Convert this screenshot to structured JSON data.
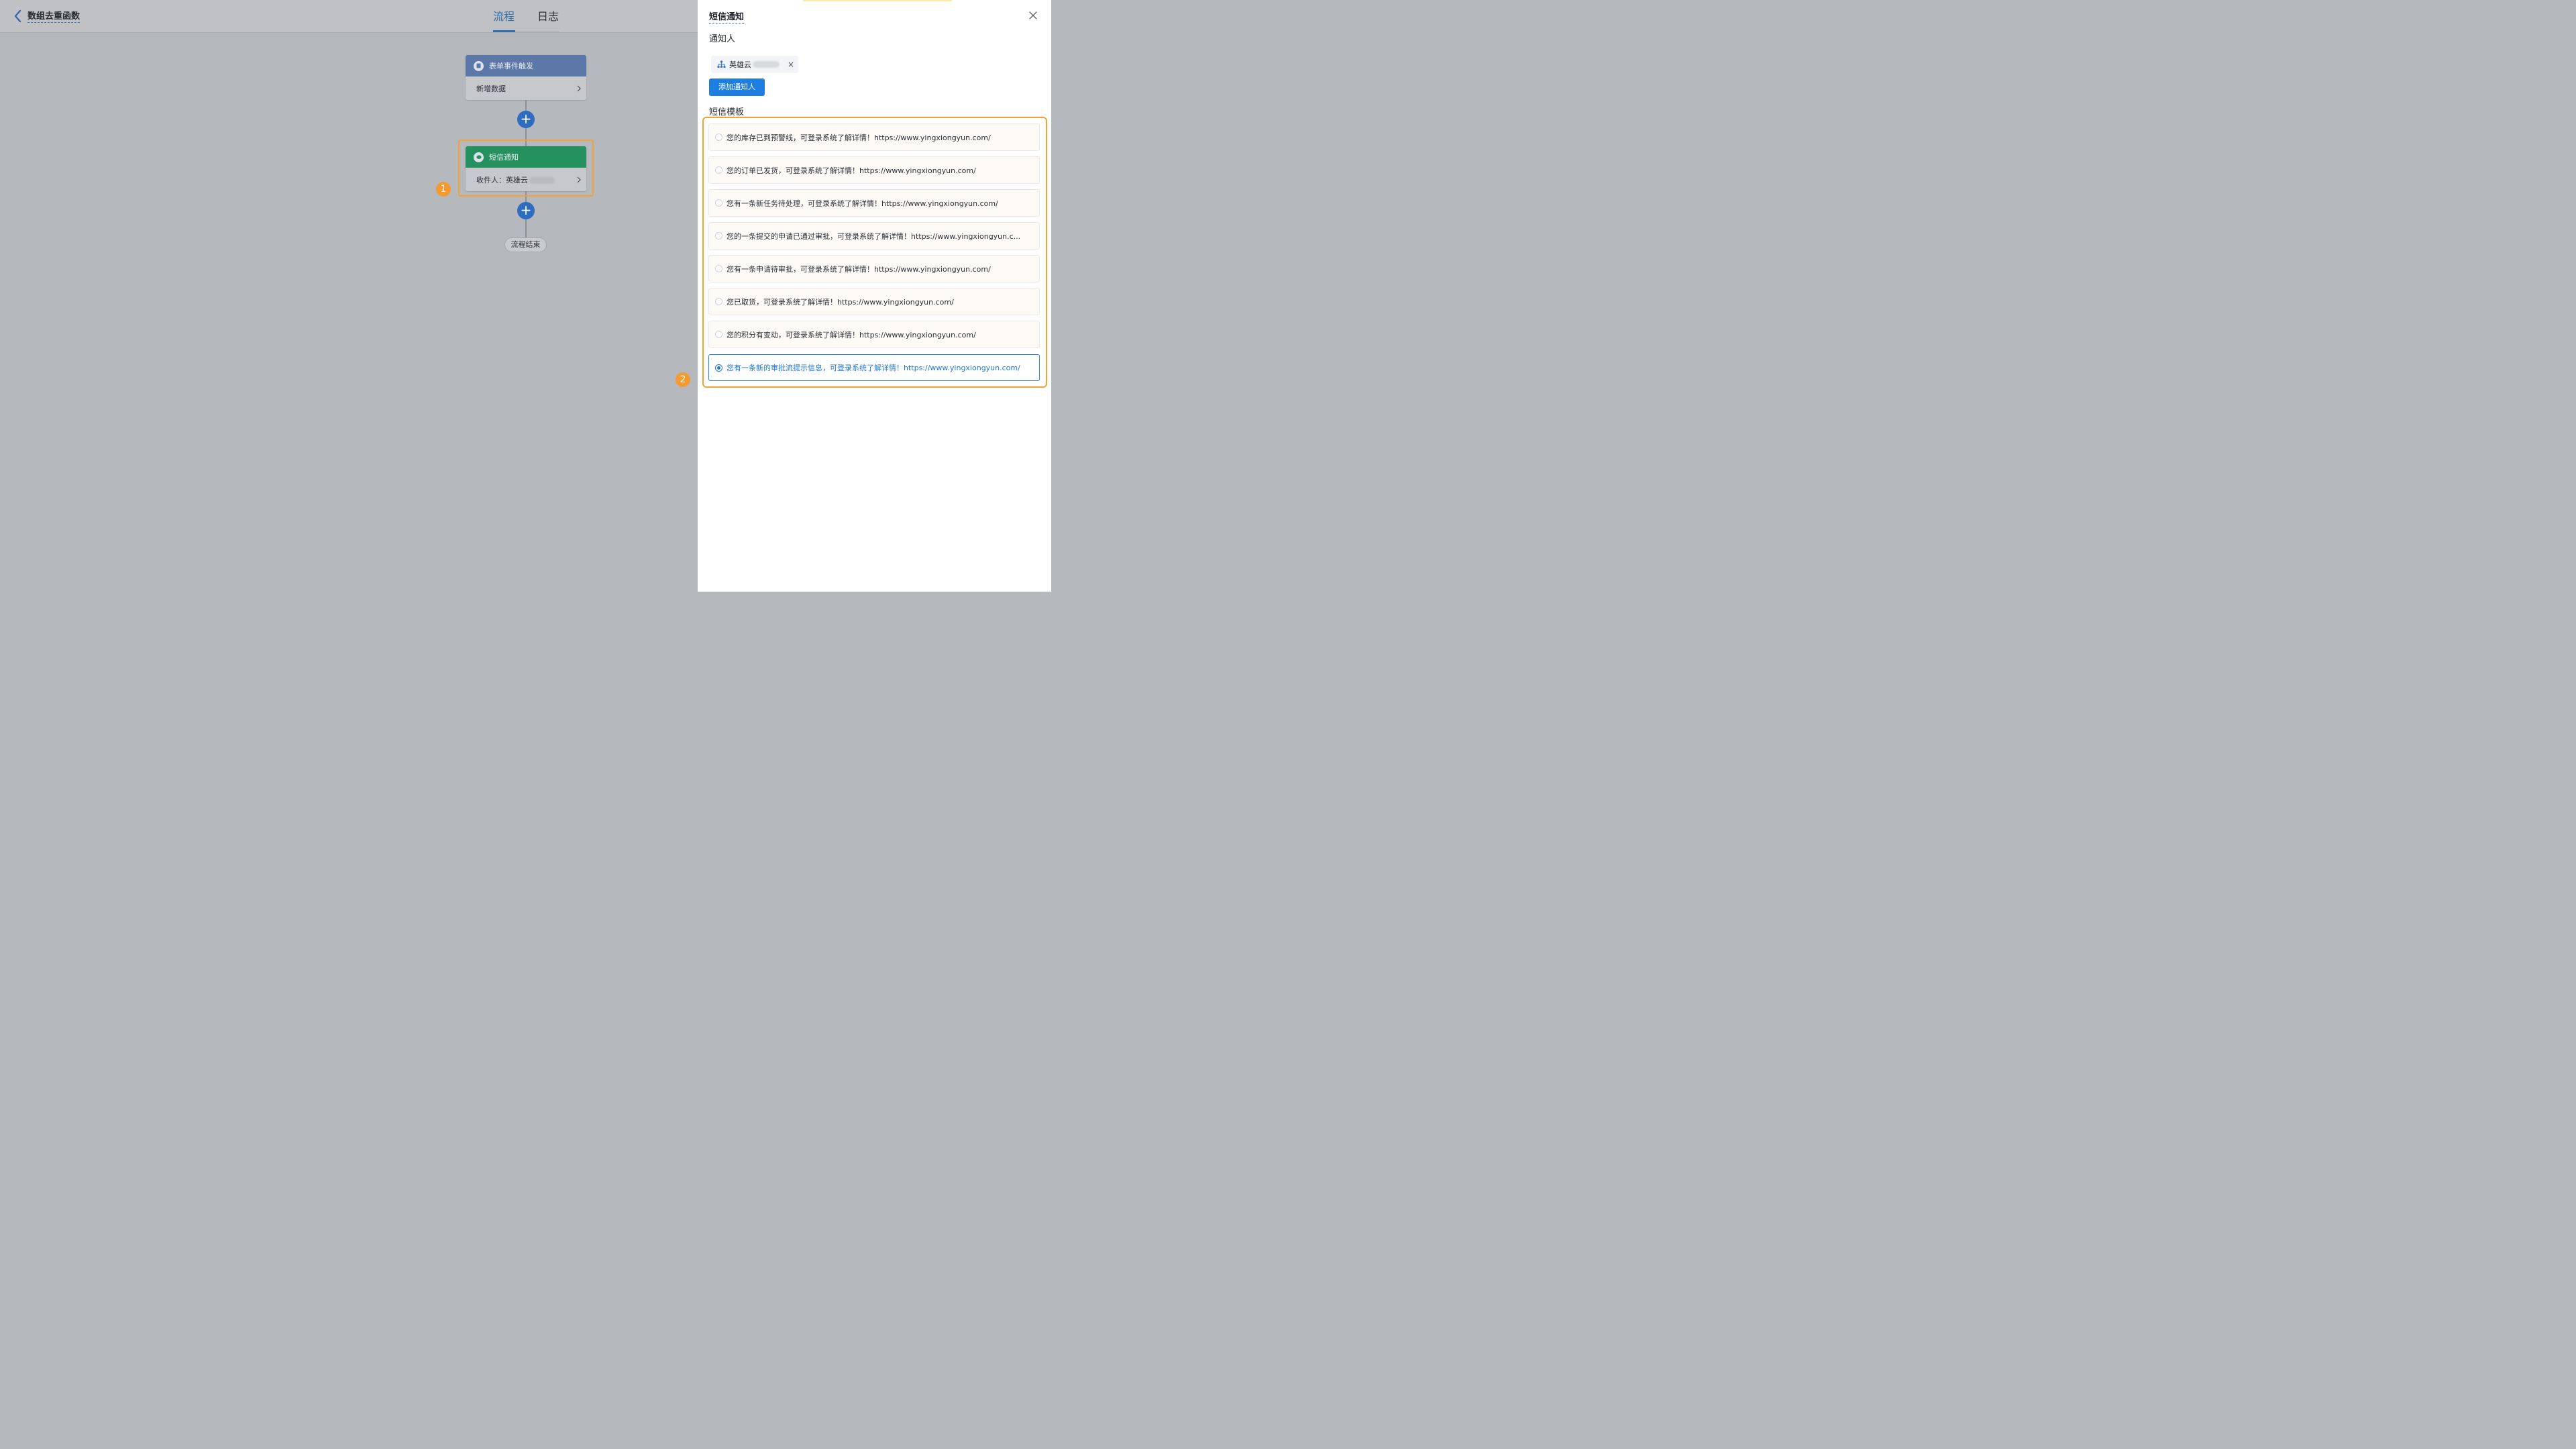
{
  "header": {
    "app_title": "数组去重函数",
    "tabs": [
      {
        "label": "流程",
        "active": true
      },
      {
        "label": "日志",
        "active": false
      }
    ]
  },
  "flow": {
    "trigger_node": {
      "title": "表单事件触发",
      "body": "新增数据"
    },
    "sms_node": {
      "title": "短信通知",
      "body": "收件人：英雄云"
    },
    "end_node": "流程结束",
    "add_symbol": "+",
    "badge_1": "1",
    "badge_2": "2"
  },
  "drawer": {
    "title": "短信通知",
    "close_symbol": "×",
    "notify_label": "通知人",
    "recipient": "英雄云",
    "chip_remove": "×",
    "add_button": "添加通知人",
    "template_label": "短信模板",
    "templates": [
      "您的库存已到预警线，可登录系统了解详情！https://www.yingxiongyun.com/",
      "您的订单已发货，可登录系统了解详情！https://www.yingxiongyun.com/",
      "您有一条新任务待处理，可登录系统了解详情！https://www.yingxiongyun.com/",
      "您的一条提交的申请已通过审批，可登录系统了解详情！https://www.yingxiongyun.c...",
      "您有一条申请待审批，可登录系统了解详情！https://www.yingxiongyun.com/",
      "您已取货，可登录系统了解详情！https://www.yingxiongyun.com/",
      "您的积分有变动，可登录系统了解详情！https://www.yingxiongyun.com/",
      "您有一条新的审批流提示信息，可登录系统了解详情！https://www.yingxiongyun.com/"
    ],
    "selected_template_index": 7
  },
  "colors": {
    "primary": "#1f7fe0",
    "highlight": "#f5a035",
    "trigger_node": "#5c78a8",
    "sms_node": "#24915e"
  }
}
